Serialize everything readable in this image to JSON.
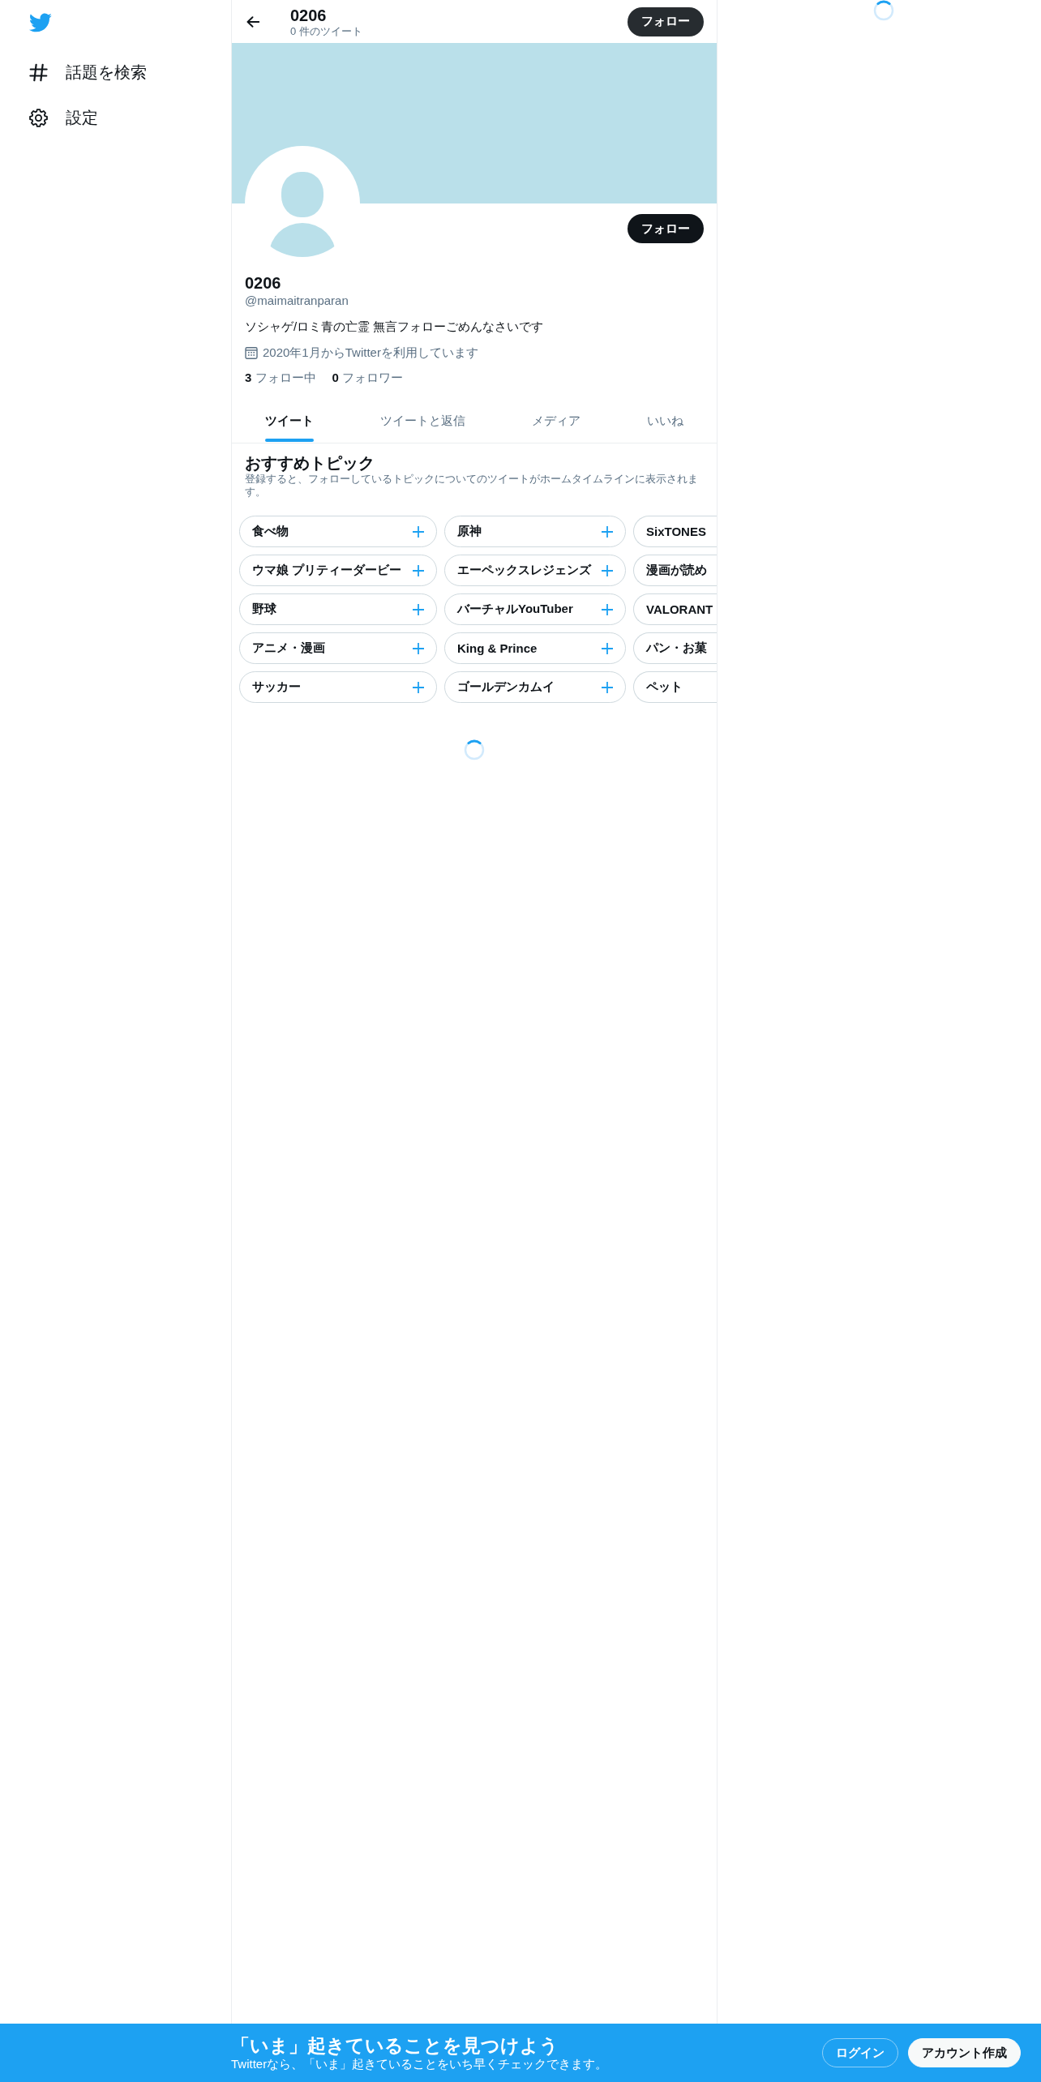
{
  "sidebar": {
    "items": [
      {
        "kind": "explore",
        "label": "話題を検索"
      },
      {
        "kind": "settings",
        "label": "設定"
      }
    ]
  },
  "header": {
    "title": "0206",
    "subtitle": "0 件のツイート",
    "button": "フォロー"
  },
  "profile": {
    "follow_button": "フォロー",
    "name": "0206",
    "handle": "@maimaitranparan",
    "bio": "ソシャゲ/ロミ青の亡霊 無言フォローごめんなさいです",
    "joined": "2020年1月からTwitterを利用しています",
    "following": {
      "count": "3",
      "label": "フォロー中"
    },
    "followers": {
      "count": "0",
      "label": "フォロワー"
    }
  },
  "tabs": [
    {
      "label": "ツイート",
      "selected": true
    },
    {
      "label": "ツイートと返信",
      "selected": false
    },
    {
      "label": "メディア",
      "selected": false
    },
    {
      "label": "いいね",
      "selected": false
    }
  ],
  "topics": {
    "title": "おすすめトピック",
    "description": "登録すると、フォローしているトピックについてのツイートがホームタイムラインに表示されます。",
    "items": [
      {
        "label": "食べ物",
        "kind": "full"
      },
      {
        "label": "原神",
        "kind": "full"
      },
      {
        "label": "SixTONES",
        "kind": "clipped"
      },
      {
        "label": "ウマ娘 プリティーダービー",
        "kind": "full"
      },
      {
        "label": "エーペックスレジェンズ",
        "kind": "full"
      },
      {
        "label": "漫画が読め",
        "kind": "clipped"
      },
      {
        "label": "野球",
        "kind": "full"
      },
      {
        "label": "バーチャルYouTuber",
        "kind": "full"
      },
      {
        "label": "VALORANT",
        "kind": "clipped"
      },
      {
        "label": "アニメ・漫画",
        "kind": "full"
      },
      {
        "label": "King & Prince",
        "kind": "full"
      },
      {
        "label": "パン・お菓",
        "kind": "clipped"
      },
      {
        "label": "サッカー",
        "kind": "full"
      },
      {
        "label": "ゴールデンカムイ",
        "kind": "full"
      },
      {
        "label": "ペット",
        "kind": "clipped"
      }
    ]
  },
  "banner": {
    "title": "「いま」起きていることを見つけよう",
    "subtitle": "Twitterなら、「いま」起きていることをいち早くチェックできます。",
    "buttons": [
      {
        "label": "ログイン",
        "kind": "login"
      },
      {
        "label": "アカウント作成",
        "kind": "signup"
      }
    ]
  }
}
